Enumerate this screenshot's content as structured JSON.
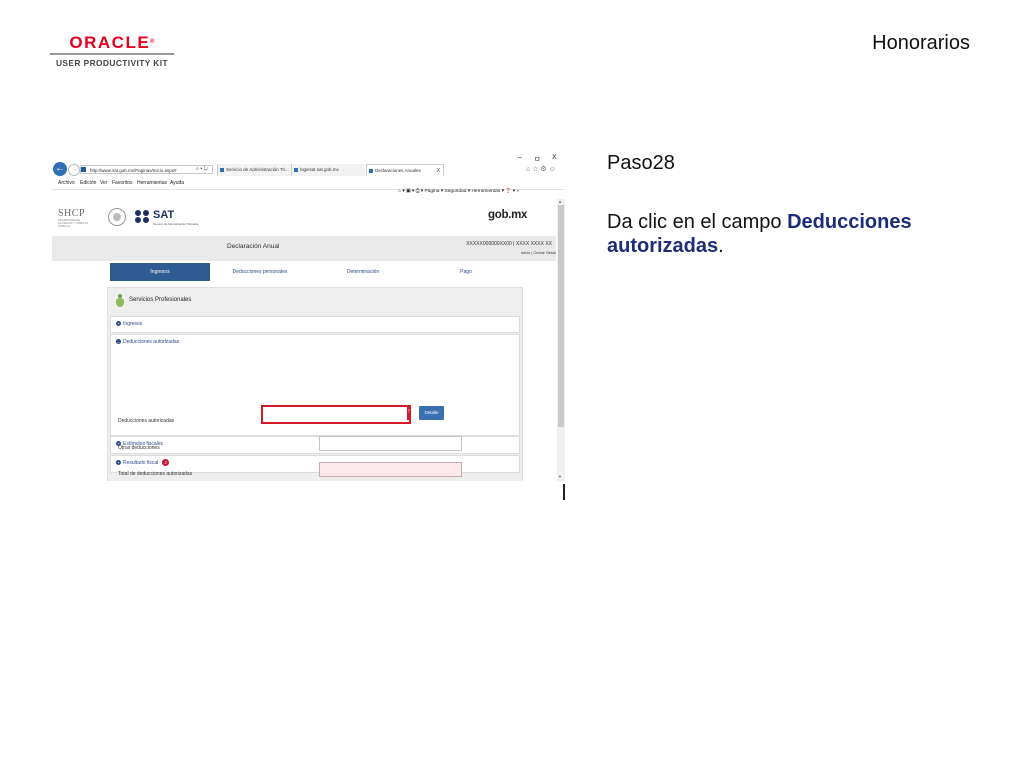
{
  "header": {
    "brand": "ORACLE",
    "brand_reg": "®",
    "product": "USER PRODUCTIVITY KIT",
    "slide_title": "Honorarios"
  },
  "step": {
    "label": "Paso28",
    "instruction_prefix": "Da clic en el campo ",
    "instruction_target": "Deducciones autorizadas",
    "instruction_suffix": "."
  },
  "browser": {
    "url": "http://www.sat.gob.mx/Paginas/Inicio.aspx#",
    "addr_buttons": "⌕ ▾ ↻",
    "tabs": [
      {
        "label": "Servicio de Administración Tri..."
      },
      {
        "label": "loginsat.sat.gob.mx"
      },
      {
        "label": "Declaraciones Anuales",
        "close": "X"
      }
    ],
    "window_controls": [
      "–",
      "ㅁ",
      "X"
    ],
    "menu": [
      "Archivo",
      "Edición",
      "Ver",
      "Favoritos",
      "Herramientas",
      "Ayuda"
    ],
    "command_bar": "⌂ ▾ ▣ ▾ ⎙ ▾ Página ▾ Seguridad ▾ Herramientas ▾ ❓ ▾ »",
    "home_icons": "⌂ ☆ ⚙ ☺"
  },
  "gov": {
    "shcp": "SHCP",
    "shcp_sub": "SECRETARÍA DE HACIENDA Y CRÉDITO PÚBLICO",
    "sat": "SAT",
    "sat_sub": "Servicio de Administración Tributaria",
    "gob": "gob.mx"
  },
  "band": {
    "title": "Declaración Anual",
    "rfc": "XXXXX000000XX00 | XXXX XXXX XX",
    "links": "Inicio | Cerrar Sesió"
  },
  "nav_tabs": [
    "Ingresos",
    "Deducciones personales",
    "Determinación",
    "Pago"
  ],
  "panel": {
    "title": "Servicios Profesionales",
    "sections": {
      "ingresos": "Ingresos",
      "deducciones": "Deducciones autorizadas",
      "estimulos": "Estímulos fiscales",
      "resultado": "Resultado fiscal",
      "resultado_badge": "2"
    },
    "rows": {
      "deducciones_autorizadas": "Deducciones autorizadas",
      "otras_deducciones": "Otras deducciones",
      "total": "Total de deducciones autorizadas"
    },
    "detalle_button": "Detalle",
    "alert_mark": "!"
  },
  "colors": {
    "oracle_red": "#e8001c",
    "highlight_red": "#d6182b",
    "nav_active": "#2f5b93",
    "link_blue": "#2c4a8a"
  }
}
